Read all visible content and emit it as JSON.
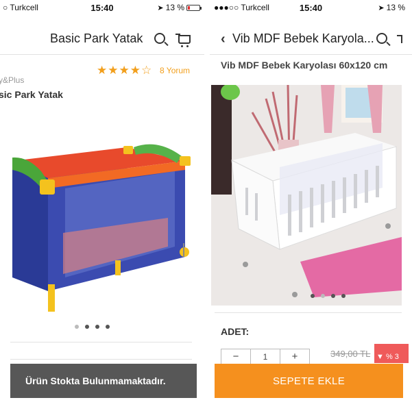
{
  "left": {
    "status": {
      "carrier": "○ Turkcell",
      "time": "15:40",
      "battery_text": "13 %",
      "battery_level": 0.13
    },
    "header": {
      "title": "Basic Park Yatak",
      "search_icon": "search-icon",
      "cart_icon": "cart-icon"
    },
    "rating": {
      "stars": "★★★★☆",
      "value": 4,
      "max": 5,
      "reviews": "8 Yorum"
    },
    "product": {
      "brand": "y&Plus",
      "name": "sic Park Yatak"
    },
    "gallery": {
      "page_count": 4,
      "active_index": 0
    },
    "stock_message": "Ürün Stokta Bulunmamaktadır.",
    "colors": {
      "star": "#f29f1c",
      "stock_bg": "#575757"
    }
  },
  "right": {
    "status": {
      "carrier": "●●●○○ Turkcell",
      "time": "15:40",
      "battery_text": "13 %"
    },
    "header": {
      "back_icon": "chevron-left-icon",
      "title": "Vib MDF Bebek Karyola...",
      "search_icon": "search-icon"
    },
    "product": {
      "title": "Vib MDF Bebek Karyolası 60x120 cm"
    },
    "gallery": {
      "page_count": 4,
      "active_index": 1
    },
    "quantity": {
      "label": "ADET:",
      "minus": "−",
      "value": "1",
      "plus": "+"
    },
    "price": {
      "old": "349,00 TL",
      "discount": "▼ % 3"
    },
    "add_to_cart": "SEPETE EKLE",
    "colors": {
      "cta": "#f5901e",
      "discount": "#ef5a5a"
    }
  }
}
